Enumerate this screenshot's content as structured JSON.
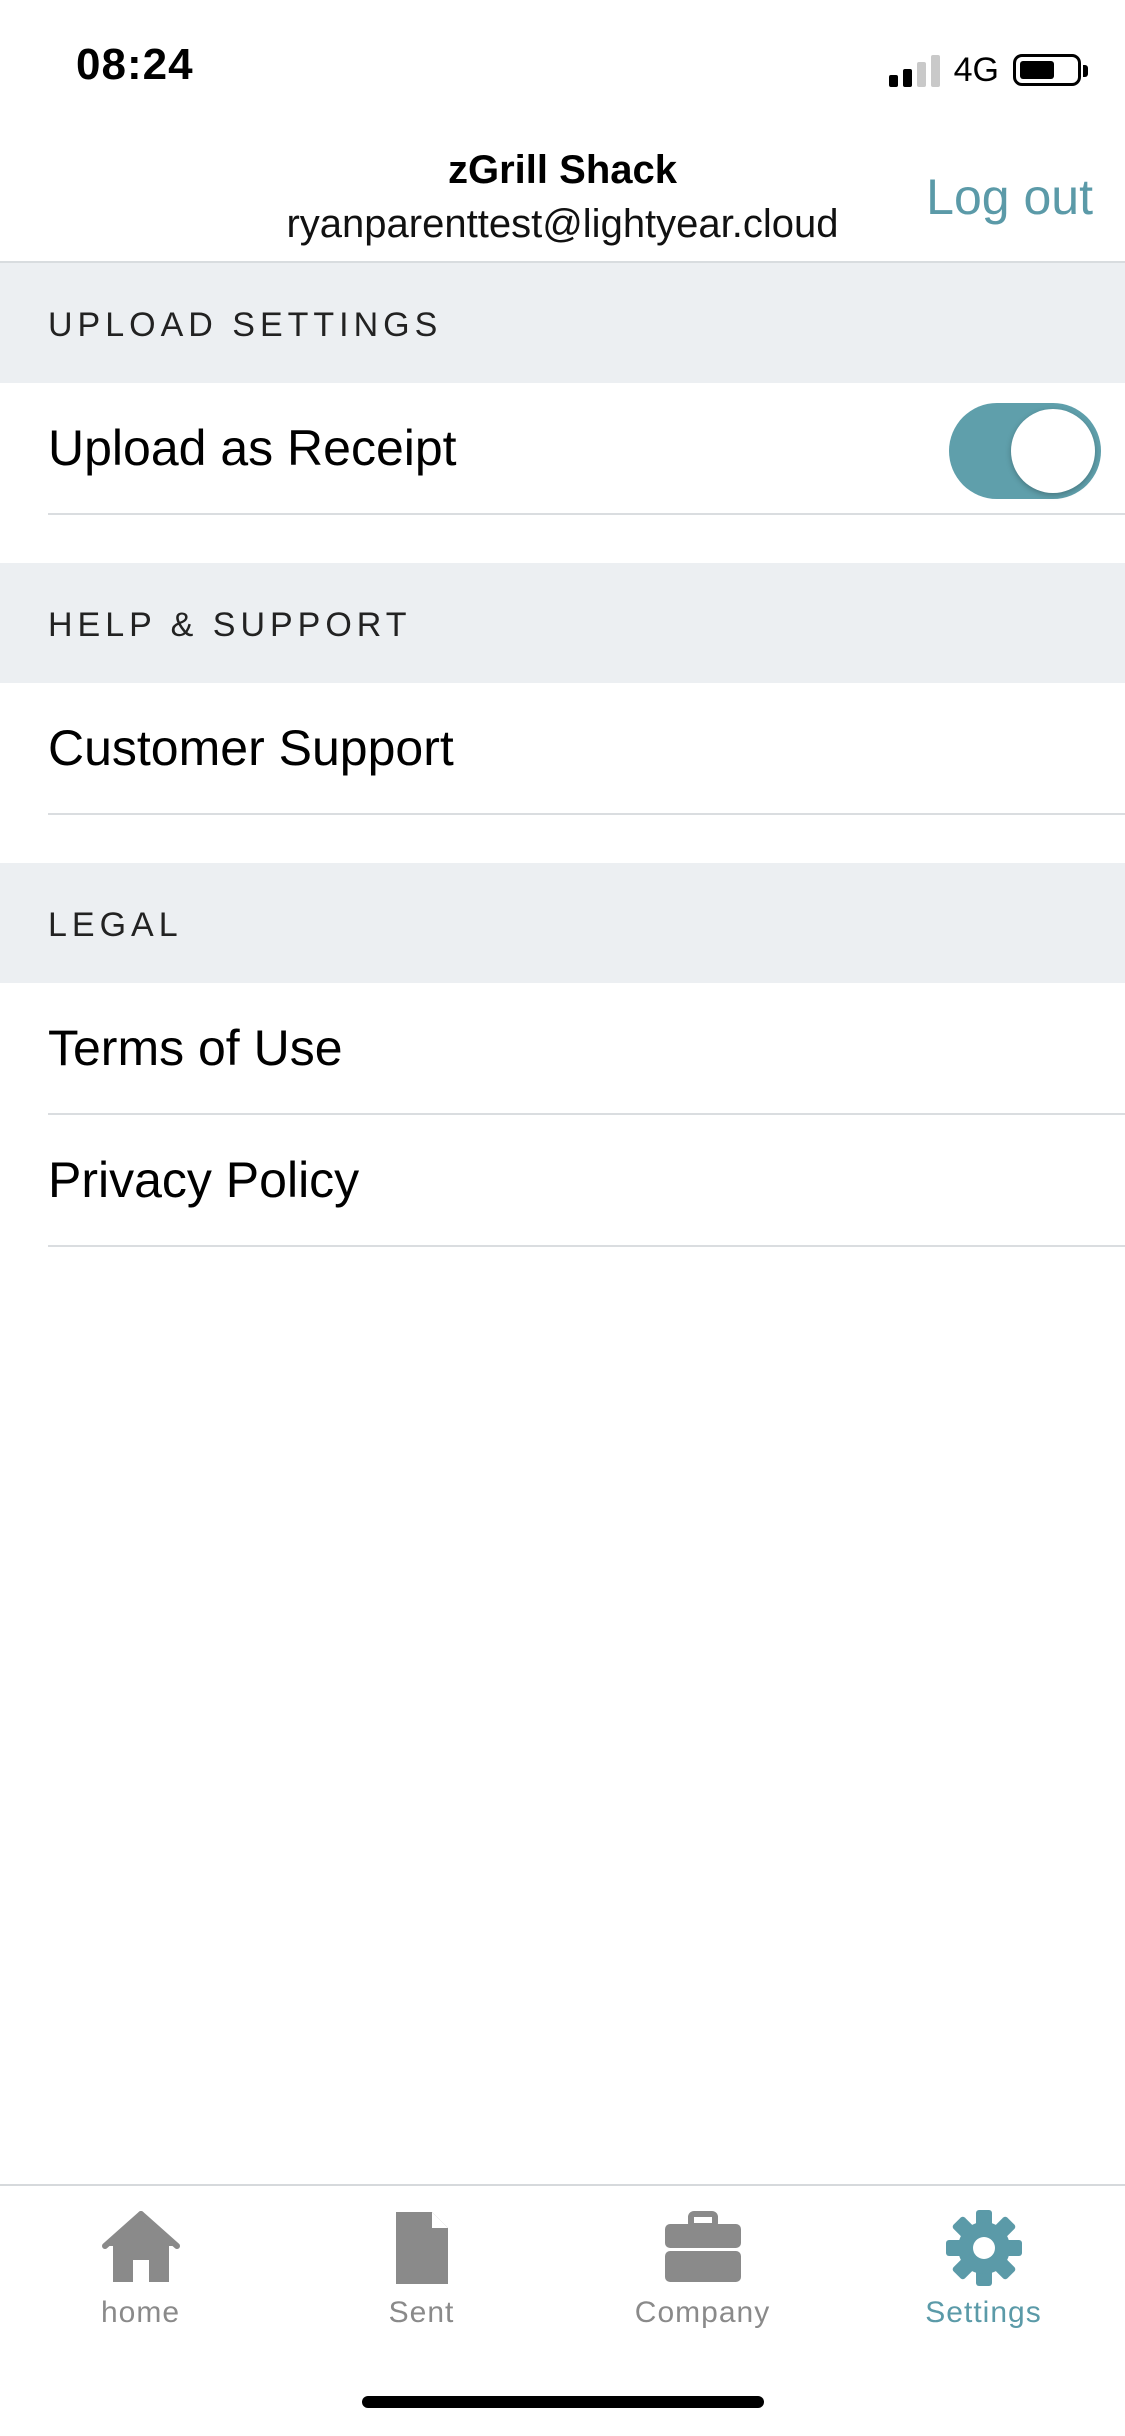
{
  "status_bar": {
    "time": "08:24",
    "network": "4G"
  },
  "header": {
    "title": "zGrill Shack",
    "subtitle": "ryanparenttest@lightyear.cloud",
    "logout_label": "Log out"
  },
  "sections": {
    "upload": {
      "title": "UPLOAD SETTINGS",
      "rows": [
        {
          "label": "Upload as Receipt",
          "toggle_on": true
        }
      ]
    },
    "help": {
      "title": "HELP & SUPPORT",
      "rows": [
        {
          "label": "Customer Support"
        }
      ]
    },
    "legal": {
      "title": "LEGAL",
      "rows": [
        {
          "label": "Terms of Use"
        },
        {
          "label": "Privacy Policy"
        }
      ]
    }
  },
  "tab_bar": {
    "tabs": [
      {
        "label": "home",
        "icon": "home-icon",
        "active": false
      },
      {
        "label": "Sent",
        "icon": "document-icon",
        "active": false
      },
      {
        "label": "Company",
        "icon": "briefcase-icon",
        "active": false
      },
      {
        "label": "Settings",
        "icon": "gear-icon",
        "active": true
      }
    ]
  },
  "colors": {
    "accent": "#5b9aa8",
    "toggle_on": "#5f9fab",
    "section_background": "#eceff2",
    "inactive_tab": "#8a8a8a"
  }
}
